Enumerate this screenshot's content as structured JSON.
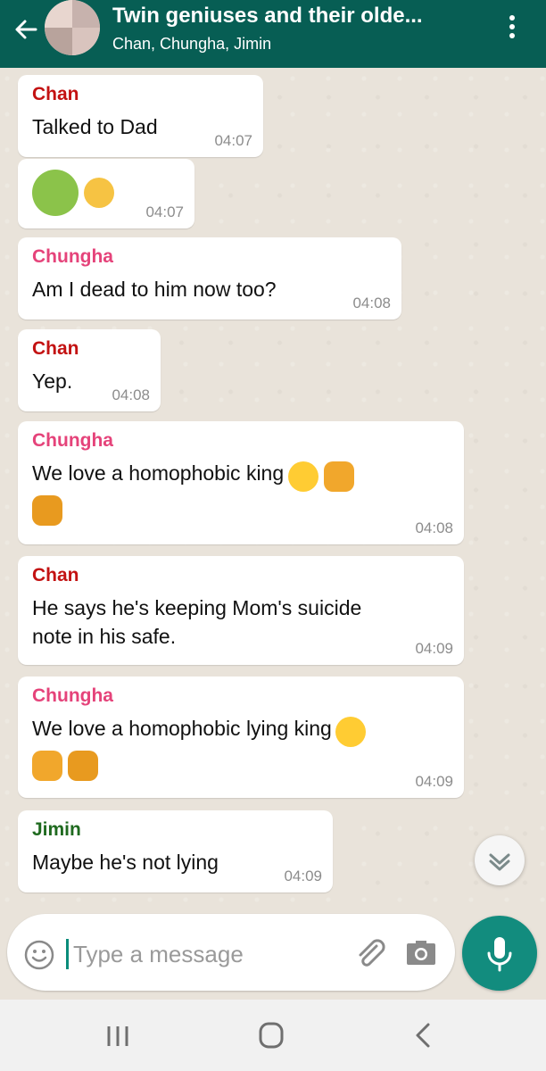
{
  "header": {
    "title": "Twin geniuses and their olde...",
    "subtitle": "Chan, Chungha, Jimin"
  },
  "messages": [
    {
      "sender": "Chan",
      "text": "Talked to Dad",
      "time": "04:07"
    },
    {
      "sender": "",
      "text": "",
      "time": "04:07",
      "emojis": [
        "sick-face",
        "vomiting-face"
      ]
    },
    {
      "sender": "Chungha",
      "text": "Am I dead to him now too?",
      "time": "04:08"
    },
    {
      "sender": "Chan",
      "text": "Yep.",
      "time": "04:08"
    },
    {
      "sender": "Chungha",
      "text": "We love a homophobic king",
      "time": "04:08",
      "emojis": [
        "pensive-face",
        "raised-fist",
        "oncoming-fist"
      ]
    },
    {
      "sender": "Chan",
      "text": "He says he's keeping Mom's suicide\nnote in his safe.",
      "time": "04:09"
    },
    {
      "sender": "Chungha",
      "text": "We love a homophobic lying king",
      "time": "04:09",
      "emojis": [
        "pensive-face",
        "raised-fist",
        "oncoming-fist"
      ]
    },
    {
      "sender": "Jimin",
      "text": "Maybe he's not lying",
      "time": "04:09"
    }
  ],
  "input": {
    "placeholder": "Type a message"
  },
  "colors": {
    "header": "#075e54",
    "chan": "#c31212",
    "chungha": "#e5437a",
    "jimin": "#1f6a1f",
    "mic": "#128c7e"
  },
  "icons": [
    "back-arrow-icon",
    "more-vert-icon",
    "scroll-down-icon",
    "emoji-icon",
    "attach-icon",
    "camera-icon",
    "mic-icon",
    "recents-icon",
    "home-icon",
    "nav-back-icon"
  ]
}
